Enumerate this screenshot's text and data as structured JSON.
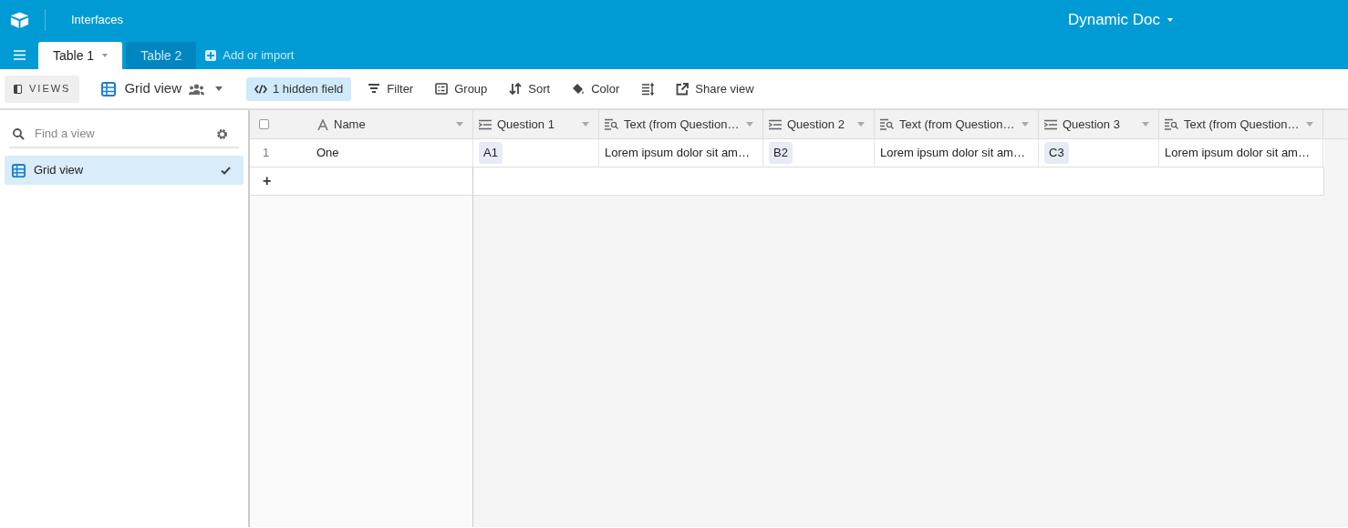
{
  "header": {
    "section": "Interfaces",
    "base_title": "Dynamic Doc"
  },
  "tabs": [
    {
      "label": "Table 1",
      "selected": true
    },
    {
      "label": "Table 2",
      "selected": false
    }
  ],
  "add_table": "Add or import",
  "toolbar": {
    "views_button": "VIEWS",
    "view_name": "Grid view",
    "hidden_fields": "1 hidden field",
    "actions": [
      {
        "kind": "filter",
        "label": "Filter"
      },
      {
        "kind": "group",
        "label": "Group"
      },
      {
        "kind": "sort",
        "label": "Sort"
      },
      {
        "kind": "color",
        "label": "Color"
      },
      {
        "kind": "height"
      },
      {
        "kind": "share",
        "label": "Share view"
      }
    ]
  },
  "sidebar": {
    "search_placeholder": "Find a view",
    "views": [
      {
        "label": "Grid view",
        "selected": true
      }
    ]
  },
  "table": {
    "select_all_checked": false,
    "columns": [
      {
        "kind": "text",
        "label": "Name"
      },
      {
        "kind": "select",
        "label": "Question 1"
      },
      {
        "kind": "lookup",
        "label": "Text (from Question…"
      },
      {
        "kind": "select",
        "label": "Question 2"
      },
      {
        "kind": "lookup",
        "label": "Text (from Question…"
      },
      {
        "kind": "select",
        "label": "Question 3"
      },
      {
        "kind": "lookup",
        "label": "Text (from Question…"
      }
    ],
    "rows": [
      {
        "number": "1",
        "cells": [
          "One",
          "A1",
          "Lorem ipsum dolor sit am…",
          "B2",
          "Lorem ipsum dolor sit am…",
          "C3",
          "Lorem ipsum dolor sit am…"
        ]
      }
    ],
    "add_row": "+"
  }
}
